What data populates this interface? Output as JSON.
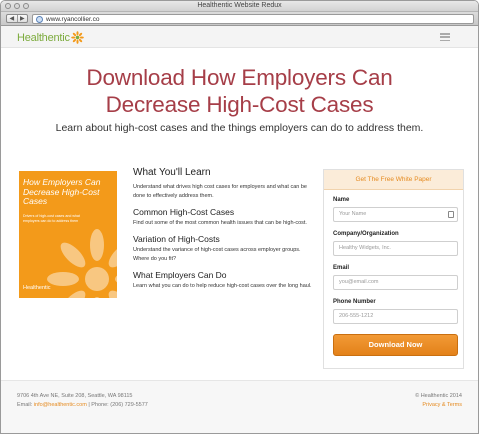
{
  "window": {
    "title": "Healthentic Website Redux",
    "url": "www.ryancollier.co",
    "nav_back": "◀",
    "nav_forward": "▶"
  },
  "header": {
    "logo_text": "Healthentic",
    "logo_icon": "flower-icon",
    "menu_icon": "hamburger-menu-icon"
  },
  "hero": {
    "headline_line1": "Download How Employers Can",
    "headline_line2": "Decrease High-Cost Cases",
    "subhead": "Learn about high-cost cases and the things employers can do to address them."
  },
  "book": {
    "title": "How Employers Can Decrease High-Cost Cases",
    "subtitle": "Drivers of high-cost cases and what employers can do to address them",
    "logo": "Healthentic"
  },
  "learn": {
    "heading": "What You'll Learn",
    "intro": "Understand what drives high cost cases for employers and what can be done to effectively address them.",
    "sections": [
      {
        "title": "Common High-Cost Cases",
        "body": "Find out some of the most common health issues that can be high-cost."
      },
      {
        "title": "Variation of High-Costs",
        "body": "Understand the variance of high-cost cases across employer groups. Where do you fit?"
      },
      {
        "title": "What Employers Can Do",
        "body": "Learn what you can do to help reduce high-cost cases over the long haul."
      }
    ]
  },
  "form": {
    "heading": "Get The Free White Paper",
    "fields": [
      {
        "label": "Name",
        "placeholder": "Your Name"
      },
      {
        "label": "Company/Organization",
        "placeholder": "Healthy Widgets, Inc."
      },
      {
        "label": "Email",
        "placeholder": "you@email.com"
      },
      {
        "label": "Phone Number",
        "placeholder": "206-555-1212"
      }
    ],
    "button": "Download Now"
  },
  "footer": {
    "address": "9706 4th Ave NE, Suite 208, Seattle, WA 98115",
    "email_label": "Email: ",
    "email": "info@healthentic.com",
    "phone": " | Phone: (206) 729-5577",
    "copyright": "© Healthentic 2014",
    "privacy_link": "Privacy & Terms"
  },
  "colors": {
    "headline": "#a63e48",
    "accent_orange": "#e58a1f",
    "logo_green": "#7cab3d"
  }
}
